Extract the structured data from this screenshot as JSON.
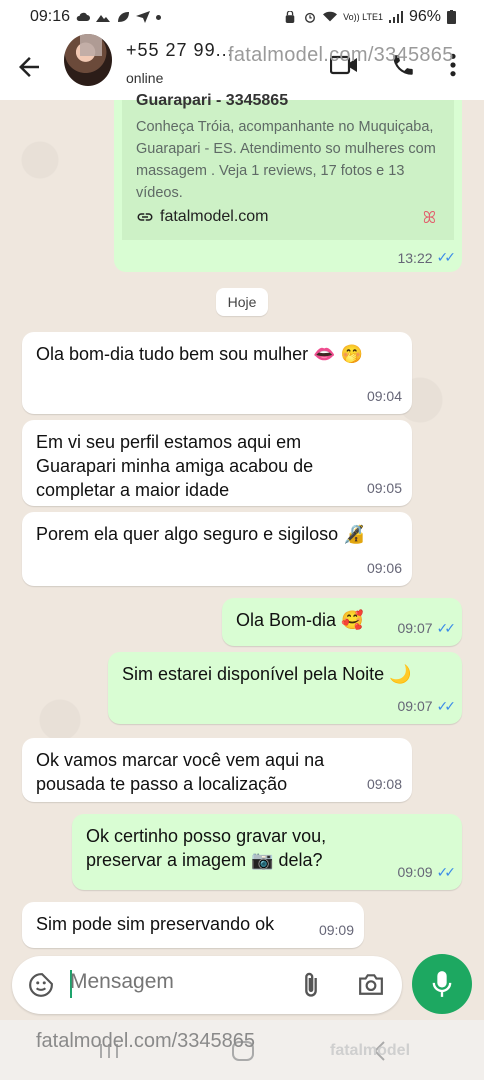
{
  "status_bar": {
    "time": "09:16",
    "battery": "96%",
    "network": "Vo)) LTE1"
  },
  "header": {
    "contact_name": "+55 27 99...",
    "contact_status": "online"
  },
  "watermark": {
    "url_top": "fatalmodel.com/3345865",
    "url_bottom": "fatalmodel.com/3345865",
    "logo": "fatalmodel"
  },
  "link_preview": {
    "title": "Guarapari - 3345865",
    "description": "Conheça Tróia, acompanhante no Muquiçaba, Guarapari - ES. Atendimento so mulheres com massagem . Veja 1 reviews, 17 fotos e 13 vídeos.",
    "link": "fatalmodel.com",
    "time": "13:22"
  },
  "date_chip": "Hoje",
  "messages": [
    {
      "dir": "in",
      "text": "Ola bom-dia tudo bem sou mulher 👄 🤭",
      "time": "09:04"
    },
    {
      "dir": "in",
      "text": "Em vi seu perfil estamos aqui em Guarapari minha amiga acabou de completar a maior idade",
      "time": "09:05"
    },
    {
      "dir": "in",
      "text": "Porem ela quer algo seguro e sigiloso 🔏",
      "time": "09:06"
    },
    {
      "dir": "out",
      "text": "Ola Bom-dia 🥰",
      "time": "09:07"
    },
    {
      "dir": "out",
      "text": "Sim estarei disponível pela Noite 🌙",
      "time": "09:07"
    },
    {
      "dir": "in",
      "text": "Ok vamos marcar você vem aqui na pousada te passo a localização",
      "time": "09:08"
    },
    {
      "dir": "out",
      "text": "Ok certinho posso gravar vou, preservar a imagem 📷 dela?",
      "time": "09:09"
    },
    {
      "dir": "in",
      "text": "Sim pode sim preservando ok",
      "time": "09:09"
    }
  ],
  "input": {
    "placeholder": "Mensagem"
  },
  "colors": {
    "outgoing": "#d9fdd3",
    "incoming": "#ffffff",
    "accent": "#1da861",
    "read_ticks": "#3b8be8"
  }
}
